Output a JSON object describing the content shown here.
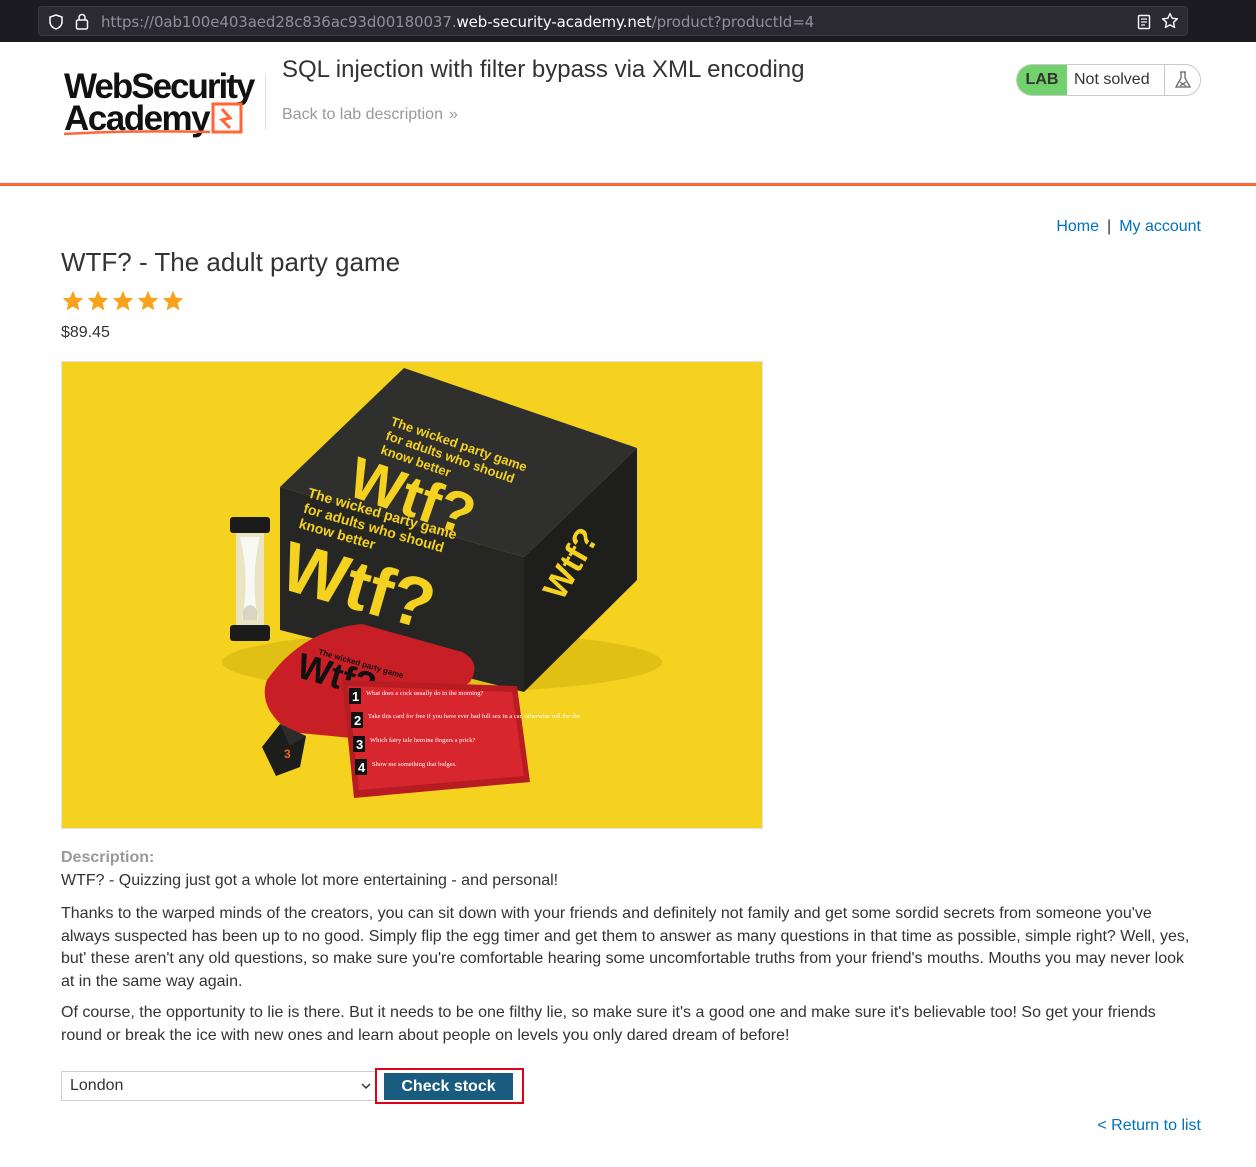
{
  "browser": {
    "url_prefix": "https://0ab100e403aed28c836ac93d00180037.",
    "url_host": "web-security-academy.net",
    "url_path": "/product?productId=4"
  },
  "lab": {
    "logo_line1": "WebSecurity",
    "logo_line2": "Academy",
    "title": "SQL injection with filter bypass via XML encoding",
    "back_link": "Back to lab description",
    "badge": "LAB",
    "status": "Not solved"
  },
  "nav": {
    "home": "Home",
    "separator": "|",
    "account": "My account"
  },
  "product": {
    "name": "WTF? - The adult party game",
    "rating": 5,
    "price": "$89.45",
    "description_label": "Description:",
    "description_lead": "WTF? - Quizzing just got a whole lot more entertaining - and personal!",
    "paragraphs": [
      "Thanks to the warped minds of the creators, you can sit down with your friends and definitely not family and get some sordid secrets from someone you've always suspected has been up to no good. Simply flip the egg timer and get them to answer as many questions in that time as possible, simple right? Well, yes, but' these aren't any old questions, so make sure you're comfortable hearing some uncomfortable truths from your friend's mouths. Mouths you may never look at in the same way again.",
      "Of course, the opportunity to lie is there. But it needs to be one filthy lie, so make sure it's a good one and make sure it's believable too! So get your friends round or break the ice with new ones and learn about people on levels you only dared dream of before!"
    ],
    "image": {
      "box_line1": "The wicked party game",
      "box_line2": "for adults who should",
      "box_line3": "know better",
      "box_brand": "Wtf?",
      "card_questions": [
        "What does a cock usually do in the morning?",
        "Take this card for free if you have ever had full sex in a car, otherwise roll the die.",
        "Which fairy tale heroine fingers a prick?",
        "Show me something that bulges."
      ]
    }
  },
  "stock": {
    "selected_store": "London",
    "button_label": "Check stock"
  },
  "footer": {
    "return_link": "< Return to list"
  },
  "colors": {
    "accent_orange": "#ff6633",
    "link_blue": "#0071bc",
    "button_blue": "#1a5c80",
    "lab_badge_green": "#70d16d",
    "star_gold": "#f9a21b",
    "highlight_red": "#e0001a"
  }
}
